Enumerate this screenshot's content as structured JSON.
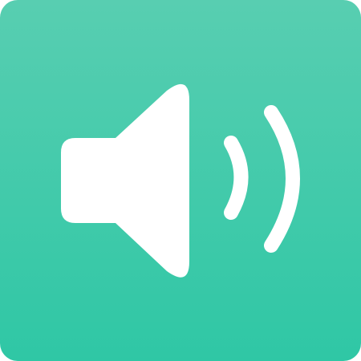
{
  "app_icon": {
    "icon": "speaker-volume-icon",
    "background_top_color": "#58ceb1",
    "background_bottom_color": "#2fc7a5",
    "glyph_color": "#ffffff"
  }
}
